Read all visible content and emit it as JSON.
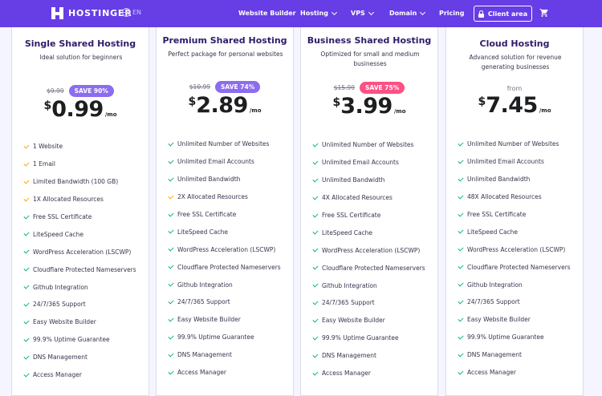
{
  "nav": {
    "brand": "HOSTINGER",
    "language": "EN",
    "items": [
      {
        "label": "Website Builder",
        "dropdown": false
      },
      {
        "label": "Hosting",
        "dropdown": true
      },
      {
        "label": "VPS",
        "dropdown": true
      },
      {
        "label": "Domain",
        "dropdown": true
      },
      {
        "label": "Pricing",
        "dropdown": false
      }
    ],
    "client_area": "Client area"
  },
  "colors": {
    "brand_purple": "#673de6",
    "check_green": "#00b090",
    "check_orange": "#ffa600",
    "save_purple": "#8c6cf0",
    "save_red": "#fc5185"
  },
  "plans": [
    {
      "name": "Single Shared Hosting",
      "subtitle": "Ideal solution for beginners",
      "old_price": "$9.99",
      "save": "SAVE 90%",
      "save_color": "purple",
      "currency": "$",
      "price": "0.99",
      "period": "/mo",
      "features": [
        {
          "text": "1 Website",
          "icon": "orange-check-icon"
        },
        {
          "text": "1 Email",
          "icon": "orange-check-icon"
        },
        {
          "text": "Limited Bandwidth (100 GB)",
          "icon": "orange-check-icon"
        },
        {
          "text": "1X Allocated Resources",
          "icon": "orange-check-icon"
        },
        {
          "text": "Free SSL Certificate",
          "icon": "green-check-icon"
        },
        {
          "text": "LiteSpeed Cache",
          "icon": "green-check-icon"
        },
        {
          "text": "WordPress Acceleration (LSCWP)",
          "icon": "green-check-icon"
        },
        {
          "text": "Cloudflare Protected Nameservers",
          "icon": "green-check-icon"
        },
        {
          "text": "Github Integration",
          "icon": "green-check-icon"
        },
        {
          "text": "24/7/365 Support",
          "icon": "green-check-icon"
        },
        {
          "text": "Easy Website Builder",
          "icon": "green-check-icon"
        },
        {
          "text": "99.9% Uptime Guarantee",
          "icon": "green-check-icon"
        },
        {
          "text": "DNS Management",
          "icon": "green-check-icon"
        },
        {
          "text": "Access Manager",
          "icon": "green-check-icon"
        }
      ]
    },
    {
      "name": "Premium Shared Hosting",
      "subtitle": "Perfect package for personal websites",
      "old_price": "$10.99",
      "save": "SAVE 74%",
      "save_color": "purple",
      "currency": "$",
      "price": "2.89",
      "period": "/mo",
      "features": [
        {
          "text": "Unlimited Number of Websites",
          "icon": "green-check-icon"
        },
        {
          "text": "Unlimited Email Accounts",
          "icon": "green-check-icon"
        },
        {
          "text": "Unlimited Bandwidth",
          "icon": "green-check-icon"
        },
        {
          "text": "2X Allocated Resources",
          "icon": "orange-check-icon"
        },
        {
          "text": "Free SSL Certificate",
          "icon": "green-check-icon"
        },
        {
          "text": "LiteSpeed Cache",
          "icon": "green-check-icon"
        },
        {
          "text": "WordPress Acceleration (LSCWP)",
          "icon": "green-check-icon"
        },
        {
          "text": "Cloudflare Protected Nameservers",
          "icon": "green-check-icon"
        },
        {
          "text": "Github Integration",
          "icon": "green-check-icon"
        },
        {
          "text": "24/7/365 Support",
          "icon": "green-check-icon"
        },
        {
          "text": "Easy Website Builder",
          "icon": "green-check-icon"
        },
        {
          "text": "99.9% Uptime Guarantee",
          "icon": "green-check-icon"
        },
        {
          "text": "DNS Management",
          "icon": "green-check-icon"
        },
        {
          "text": "Access Manager",
          "icon": "green-check-icon"
        }
      ]
    },
    {
      "name": "Business Shared Hosting",
      "subtitle": "Optimized for small and medium businesses",
      "old_price": "$15.99",
      "save": "SAVE 75%",
      "save_color": "red",
      "currency": "$",
      "price": "3.99",
      "period": "/mo",
      "features": [
        {
          "text": "Unlimited Number of Websites",
          "icon": "green-check-icon"
        },
        {
          "text": "Unlimited Email Accounts",
          "icon": "green-check-icon"
        },
        {
          "text": "Unlimited Bandwidth",
          "icon": "green-check-icon"
        },
        {
          "text": "4X Allocated Resources",
          "icon": "green-check-icon"
        },
        {
          "text": "Free SSL Certificate",
          "icon": "green-check-icon"
        },
        {
          "text": "LiteSpeed Cache",
          "icon": "green-check-icon"
        },
        {
          "text": "WordPress Acceleration (LSCWP)",
          "icon": "green-check-icon"
        },
        {
          "text": "Cloudflare Protected Nameservers",
          "icon": "green-check-icon"
        },
        {
          "text": "Github Integration",
          "icon": "green-check-icon"
        },
        {
          "text": "24/7/365 Support",
          "icon": "green-check-icon"
        },
        {
          "text": "Easy Website Builder",
          "icon": "green-check-icon"
        },
        {
          "text": "99.9% Uptime Guarantee",
          "icon": "green-check-icon"
        },
        {
          "text": "DNS Management",
          "icon": "green-check-icon"
        },
        {
          "text": "Access Manager",
          "icon": "green-check-icon"
        }
      ]
    },
    {
      "name": "Cloud Hosting",
      "subtitle": "Advanced solution for revenue generating businesses",
      "from": "from",
      "currency": "$",
      "price": "7.45",
      "period": "/mo",
      "features": [
        {
          "text": "Unlimited Number of Websites",
          "icon": "green-check-icon"
        },
        {
          "text": "Unlimited Email Accounts",
          "icon": "green-check-icon"
        },
        {
          "text": "Unlimited Bandwidth",
          "icon": "green-check-icon"
        },
        {
          "text": "48X Allocated Resources",
          "icon": "green-check-icon"
        },
        {
          "text": "Free SSL Certificate",
          "icon": "green-check-icon"
        },
        {
          "text": "LiteSpeed Cache",
          "icon": "green-check-icon"
        },
        {
          "text": "WordPress Acceleration (LSCWP)",
          "icon": "green-check-icon"
        },
        {
          "text": "Cloudflare Protected Nameservers",
          "icon": "green-check-icon"
        },
        {
          "text": "Github Integration",
          "icon": "green-check-icon"
        },
        {
          "text": "24/7/365 Support",
          "icon": "green-check-icon"
        },
        {
          "text": "Easy Website Builder",
          "icon": "green-check-icon"
        },
        {
          "text": "99.9% Uptime Guarantee",
          "icon": "green-check-icon"
        },
        {
          "text": "DNS Management",
          "icon": "green-check-icon"
        },
        {
          "text": "Access Manager",
          "icon": "green-check-icon"
        }
      ]
    }
  ]
}
